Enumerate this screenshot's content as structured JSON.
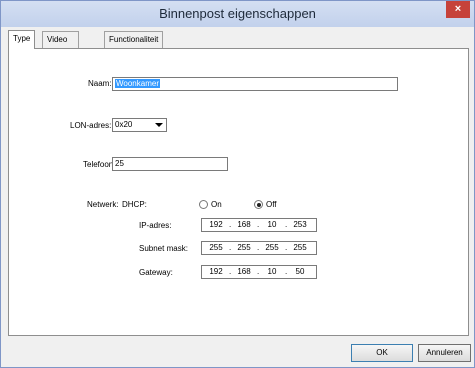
{
  "window": {
    "title": "Binnenpost eigenschappen",
    "close_glyph": "×"
  },
  "tabs": [
    {
      "label": "Type",
      "active": true
    },
    {
      "label": "Video selectie",
      "active": false
    },
    {
      "label": "Functionaliteit",
      "active": false
    }
  ],
  "form": {
    "naam": {
      "label": "Naam:",
      "value": "Woonkamer"
    },
    "lon": {
      "label": "LON-adres:",
      "value": "0x20"
    },
    "telefoon": {
      "label": "Telefoon:",
      "value": "25"
    },
    "netwerk": {
      "label": "Netwerk:",
      "dhcp_label": "DHCP:",
      "dhcp_on": "On",
      "dhcp_off": "Off",
      "dhcp_selected": "Off",
      "ip": {
        "label": "IP-adres:",
        "octets": [
          "192",
          "168",
          "10",
          "253"
        ]
      },
      "subnet": {
        "label": "Subnet mask:",
        "octets": [
          "255",
          "255",
          "255",
          "255"
        ]
      },
      "gateway": {
        "label": "Gateway:",
        "octets": [
          "192",
          "168",
          "10",
          "50"
        ]
      }
    }
  },
  "buttons": {
    "ok": "OK",
    "cancel": "Annuleren"
  },
  "colors": {
    "titlebar": "#c8d6ef",
    "close": "#c6423a",
    "selection": "#3399ff"
  }
}
